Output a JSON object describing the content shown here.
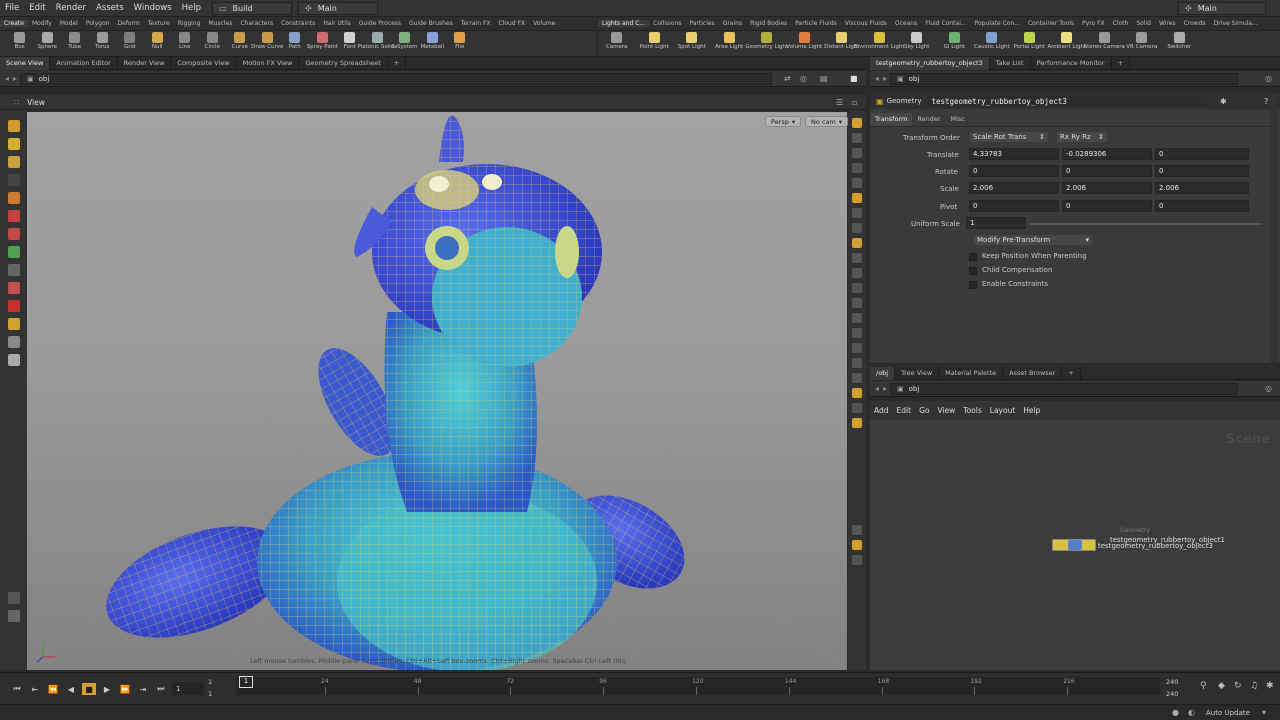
{
  "menubar": {
    "items": [
      "File",
      "Edit",
      "Render",
      "Assets",
      "Windows",
      "Help"
    ],
    "desktop": "Build",
    "context": "Main",
    "right_context": "Main"
  },
  "shelf_tabs_left": [
    "Create",
    "Modify",
    "Model",
    "Polygon",
    "Deform",
    "Texture",
    "Rigging",
    "Muscles",
    "Characters",
    "Constraints",
    "Hair Utils",
    "Guide Process",
    "Guide Brushes",
    "Terrain FX",
    "Cloud FX",
    "Volume"
  ],
  "shelf_tabs_right": [
    "Lights and C...",
    "Collisions",
    "Particles",
    "Grains",
    "Rigid Bodies",
    "Particle Fluids",
    "Viscous Fluids",
    "Oceans",
    "Fluid Contai...",
    "Populate Con...",
    "Container Tools",
    "Pyro FX",
    "Cloth",
    "Solid",
    "Wires",
    "Crowds",
    "Drive Simula..."
  ],
  "tools_left": [
    {
      "label": "Box",
      "color": "#9a9a9a"
    },
    {
      "label": "Sphere",
      "color": "#a8a8a8"
    },
    {
      "label": "Tube",
      "color": "#8c8c8c"
    },
    {
      "label": "Torus",
      "color": "#9c9c9c"
    },
    {
      "label": "Grid",
      "color": "#7d7d7d"
    },
    {
      "label": "Null",
      "color": "#d4a84a"
    },
    {
      "label": "Line",
      "color": "#888"
    },
    {
      "label": "Circle",
      "color": "#888"
    },
    {
      "label": "Curve",
      "color": "#c69b4a"
    },
    {
      "label": "Draw Curve",
      "color": "#c69b4a"
    },
    {
      "label": "Path",
      "color": "#8aa0c8"
    },
    {
      "label": "Spray Paint",
      "color": "#d06a6a"
    },
    {
      "label": "Font",
      "color": "#cfcfcf"
    },
    {
      "label": "Platonic Solids",
      "color": "#9aa"
    },
    {
      "label": "L-System",
      "color": "#7fb07f"
    },
    {
      "label": "Metaball",
      "color": "#88a0d8"
    },
    {
      "label": "File",
      "color": "#e0a048"
    }
  ],
  "tools_right": [
    {
      "label": "Camera",
      "color": "#999"
    },
    {
      "label": "Point Light",
      "color": "#e8d070"
    },
    {
      "label": "Spot Light",
      "color": "#e8d070"
    },
    {
      "label": "Area Light",
      "color": "#e8c060"
    },
    {
      "label": "Geometry Light",
      "color": "#b0b040"
    },
    {
      "label": "Volume Light",
      "color": "#e08040"
    },
    {
      "label": "Distant Light",
      "color": "#e8d070"
    },
    {
      "label": "Environment Light",
      "color": "#d8c040"
    },
    {
      "label": "Sky Light",
      "color": "#c8c8c8"
    },
    {
      "label": "GI Light",
      "color": "#70b070"
    },
    {
      "label": "Caustic Light",
      "color": "#80a0d0"
    },
    {
      "label": "Portal Light",
      "color": "#c0d050"
    },
    {
      "label": "Ambient Light",
      "color": "#e8e080"
    },
    {
      "label": "Stereo Camera",
      "color": "#999"
    },
    {
      "label": "VR Camera",
      "color": "#999"
    },
    {
      "label": "Switcher",
      "color": "#aaa"
    }
  ],
  "left_tabs": [
    "Scene View",
    "Animation Editor",
    "Render View",
    "Composite View",
    "Motion FX View",
    "Geometry Spreadsheet"
  ],
  "left_path": "obj",
  "view_label": "View",
  "viewport": {
    "persp": "Persp",
    "cam": "No cam",
    "hint": "Left mouse tumbles. Middle pans. Right dollies. Ctrl+Alt+Left box-zooms. Ctrl+Right zooms. Spacebar-Ctrl-Left tilts."
  },
  "right_tabs": [
    "testgeometry_rubbertoy_object3",
    "Take List",
    "Performance Monitor"
  ],
  "right_path": "obj",
  "params": {
    "type": "Geometry",
    "node_name": "testgeometry_rubbertoy_object3",
    "tabs": [
      "Transform",
      "Render",
      "Misc"
    ],
    "transform_order_label": "Transform Order",
    "transform_order": "Scale Rot Trans",
    "rot_order": "Rx Ry Rz",
    "translate_label": "Translate",
    "translate": [
      "4.33783",
      "-0.0289306",
      "0"
    ],
    "rotate_label": "Rotate",
    "rotate": [
      "0",
      "0",
      "0"
    ],
    "scale_label": "Scale",
    "scale": [
      "2.006",
      "2.006",
      "2.006"
    ],
    "pivot_label": "Pivot",
    "pivot": [
      "0",
      "0",
      "0"
    ],
    "uniform_label": "Uniform Scale",
    "uniform": "1",
    "modify_pre": "Modify Pre-Transform",
    "keep_position": "Keep Position When Parenting",
    "child_comp": "Child Compensation",
    "enable_constraints": "Enable Constraints"
  },
  "net_tabs": [
    "/obj",
    "Tree View",
    "Material Palette",
    "Asset Browser"
  ],
  "net_path": "obj",
  "net_menu": [
    "Add",
    "Edit",
    "Go",
    "View",
    "Tools",
    "Layout",
    "Help"
  ],
  "net_watermark": "Scene",
  "nodes": {
    "type_label": "Geometry",
    "node1": "testgeometry_rubbertoy_object1",
    "node3": "testgeometry_rubbertoy_object3"
  },
  "timeline": {
    "current": "1",
    "start": "1",
    "start2": "1",
    "ticks": [
      "24",
      "48",
      "72",
      "96",
      "120",
      "144",
      "168",
      "192",
      "216"
    ],
    "end": "240",
    "end2": "240",
    "frame_box": "1"
  },
  "status": {
    "auto_update": "Auto Update"
  },
  "colors": {
    "accent": "#e0a040",
    "viewport_top": "#a2a2a2",
    "wire": "#e8c850",
    "toy_blue": "#3a4fd0",
    "toy_cyan": "#40b8c8"
  }
}
